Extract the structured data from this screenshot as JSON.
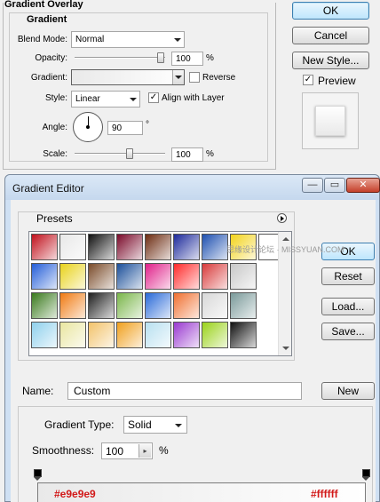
{
  "layer_style": {
    "group_title": "Gradient Overlay",
    "subgroup_title": "Gradient",
    "blend_mode_label": "Blend Mode:",
    "blend_mode_value": "Normal",
    "opacity_label": "Opacity:",
    "opacity_value": "100",
    "percent": "%",
    "gradient_label": "Gradient:",
    "reverse_label": "Reverse",
    "reverse_checked": false,
    "style_label": "Style:",
    "style_value": "Linear",
    "align_label": "Align with Layer",
    "align_checked": true,
    "angle_label": "Angle:",
    "angle_value": "90",
    "degree": "°",
    "scale_label": "Scale:",
    "scale_value": "100",
    "buttons": {
      "ok": "OK",
      "cancel": "Cancel",
      "new_style": "New Style..."
    },
    "preview_label": "Preview",
    "preview_checked": true
  },
  "gradient_editor": {
    "title": "Gradient Editor",
    "presets_label": "Presets",
    "presets_rows": [
      [
        "#c0101c",
        "#e8e8e8",
        "#111111",
        "#7a0a2a",
        "#6d2c12",
        "#1d2a9b",
        "#1d4fb0",
        "#f3d31a",
        "#ffffff"
      ],
      [
        "#245ed8",
        "#e8d21a",
        "#7a4b2a",
        "#1b4f9a",
        "#e0218a",
        "#ff2a2a",
        "#d83a3a",
        "#c8c8c8",
        ""
      ],
      [
        "#3a7b1e",
        "#f07a12",
        "#202020",
        "#7ab64a",
        "#2a6ad8",
        "#f07030",
        "#d8d8d8",
        "#7a9a9a",
        ""
      ],
      [
        "#8fd0ec",
        "#e9e6a0",
        "#f2c26a",
        "#f0a01e",
        "#b8e0f0",
        "#9a3ad0",
        "#9ad21a",
        "#111111",
        ""
      ]
    ],
    "buttons": {
      "ok": "OK",
      "reset": "Reset",
      "load": "Load...",
      "save": "Save...",
      "new": "New"
    },
    "name_label": "Name:",
    "name_value": "Custom",
    "gradient_type_label": "Gradient Type:",
    "gradient_type_value": "Solid",
    "smoothness_label": "Smoothness:",
    "smoothness_value": "100",
    "percent": "%",
    "stop_left_color": "#e9e9e9",
    "stop_right_color": "#ffffff",
    "stop_left_label": "#e9e9e9",
    "stop_right_label": "#ffffff",
    "watermark": "思缘设计论坛 · MISSYUAN.COM"
  }
}
